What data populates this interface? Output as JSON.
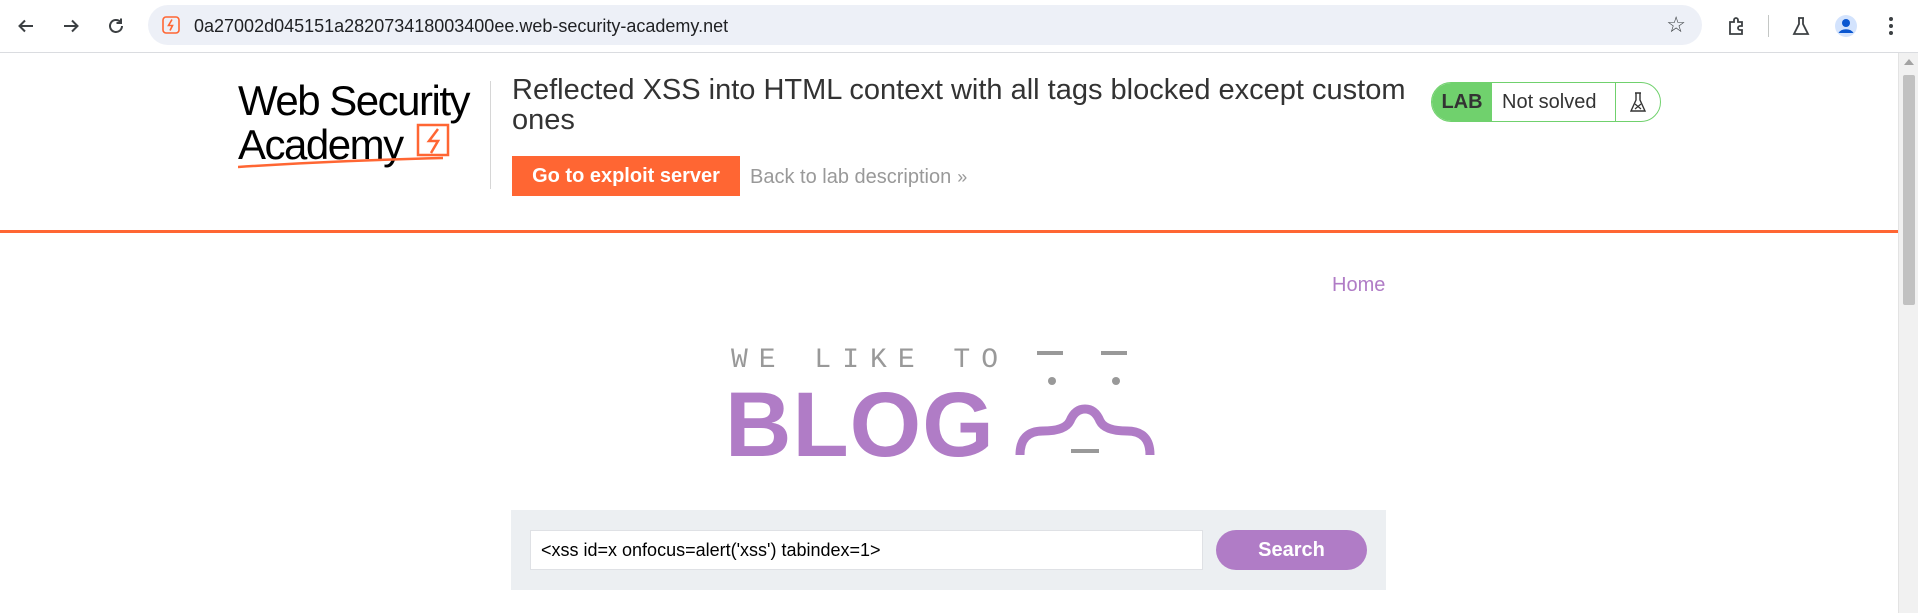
{
  "browser": {
    "url": "0a27002d045151a282073418003400ee.web-security-academy.net"
  },
  "academy": {
    "logo_line1": "Web Security",
    "logo_line2": "Academy",
    "lab_title": "Reflected XSS into HTML context with all tags blocked except custom ones",
    "exploit_button": "Go to exploit server",
    "back_link": "Back to lab description",
    "badge_tag": "LAB",
    "badge_status": "Not solved",
    "accent_color": "#ff6633",
    "solved_color": "#70d16d"
  },
  "page": {
    "nav_home": "Home",
    "blog_tagline": "WE LIKE TO",
    "blog_word": "BLOG",
    "search_value": "<xss id=x onfocus=alert('xss') tabindex=1>",
    "search_button": "Search",
    "brand_color": "#b07cc6"
  }
}
